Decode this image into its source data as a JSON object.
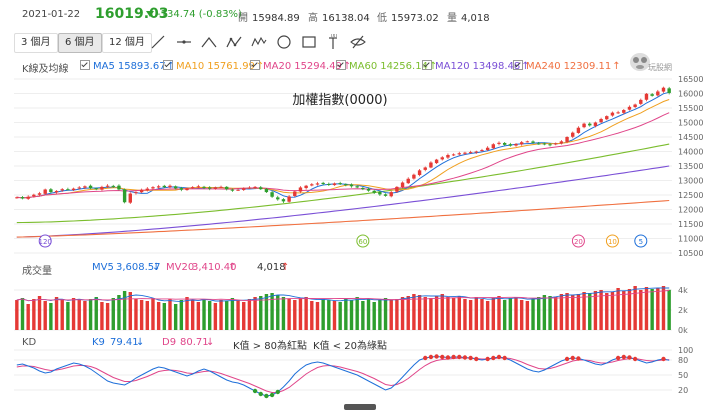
{
  "quote": {
    "date": "2021-01-22",
    "price": "16019.03",
    "change": "-134.74 (-0.83%)",
    "open_label": "開",
    "open": "15984.89",
    "high_label": "高",
    "high": "16138.04",
    "low_label": "低",
    "low": "15973.02",
    "volume_label": "量",
    "volume": "4,018"
  },
  "toolbar": {
    "ranges": [
      "3 個月",
      "6 個月",
      "12 個月"
    ],
    "active_range": "6 個月",
    "tools": [
      "line-tool-icon",
      "horizontal-line-icon",
      "peak-line-icon",
      "wave-icon",
      "multi-wave-icon",
      "circle-icon",
      "rectangle-icon",
      "text-tool-icon",
      "hide-icon"
    ]
  },
  "ma_row": {
    "label": "K線及均線",
    "items": [
      {
        "name": "MA5",
        "value": "15893.67",
        "arrow": "↑",
        "color": "#1e6fd9"
      },
      {
        "name": "MA10",
        "value": "15761.99",
        "arrow": "↑",
        "color": "#f0a020"
      },
      {
        "name": "MA20",
        "value": "15294.49",
        "arrow": "↑",
        "color": "#e0468a"
      },
      {
        "name": "MA60",
        "value": "14256.14",
        "arrow": "↑",
        "color": "#7bbd2e"
      },
      {
        "name": "MA120",
        "value": "13498.48",
        "arrow": "↑",
        "color": "#7a4fd6"
      },
      {
        "name": "MA240",
        "value": "12309.11",
        "arrow": "↑",
        "color": "#f07040"
      }
    ]
  },
  "logo_text": "玩股網",
  "volume_row": {
    "label": "成交量",
    "mv5_name": "MV5",
    "mv5_value": "3,608.57",
    "mv5_arrow": "↓",
    "mv20_name": "MV20",
    "mv20_value": "3,410.40",
    "mv20_arrow": "↑",
    "vol_value": "4,018",
    "vol_arrow": "↑"
  },
  "kd_row": {
    "label": "KD",
    "k_name": "K9",
    "k_value": "79.41",
    "k_arrow": "↓",
    "d_name": "D9",
    "d_value": "80.71",
    "d_arrow": "↓",
    "note1": "K值 > 80為紅點",
    "note2": "K值 < 20為綠點"
  },
  "colors": {
    "up": "#e53935",
    "down": "#2e9e2e",
    "grid": "#eeeeee"
  },
  "chart_data": [
    {
      "type": "candlestick",
      "title": "加權指數(0000)",
      "ylim": [
        10500,
        16500
      ],
      "yticks": [
        10500,
        11000,
        11500,
        12000,
        12500,
        13000,
        13500,
        14000,
        14500,
        15000,
        15500,
        16000,
        16500
      ],
      "markers": [
        "120",
        "60",
        "20",
        "10",
        "5"
      ],
      "close": [
        12420,
        12380,
        12440,
        12510,
        12560,
        12690,
        12600,
        12640,
        12700,
        12690,
        12720,
        12760,
        12800,
        12730,
        12700,
        12780,
        12820,
        12800,
        12690,
        12250,
        12550,
        12600,
        12680,
        12720,
        12770,
        12800,
        12770,
        12820,
        12730,
        12680,
        12730,
        12770,
        12800,
        12750,
        12720,
        12760,
        12780,
        12700,
        12660,
        12680,
        12730,
        12760,
        12780,
        12700,
        12600,
        12440,
        12350,
        12280,
        12450,
        12620,
        12760,
        12820,
        12870,
        12900,
        12880,
        12860,
        12900,
        12880,
        12840,
        12800,
        12760,
        12700,
        12650,
        12580,
        12520,
        12470,
        12600,
        12780,
        12930,
        13060,
        13200,
        13350,
        13450,
        13620,
        13720,
        13800,
        13880,
        13900,
        13940,
        13960,
        13980,
        14000,
        14050,
        14130,
        14250,
        14300,
        14230,
        14200,
        14260,
        14320,
        14350,
        14300,
        14270,
        14260,
        14230,
        14280,
        14350,
        14500,
        14650,
        14820,
        14960,
        14900,
        15000,
        15120,
        15220,
        15340,
        15350,
        15430,
        15540,
        15620,
        15780,
        15990,
        15920,
        16070,
        16200,
        16019
      ]
    },
    {
      "type": "bar",
      "name": "成交量",
      "ylim": [
        0,
        5000
      ],
      "yticks": [
        "4k",
        "2k",
        "0k"
      ],
      "values": [
        3000,
        3200,
        2600,
        3100,
        3400,
        2900,
        2700,
        3300,
        3100,
        2800,
        3200,
        3000,
        2900,
        3100,
        3300,
        2800,
        2700,
        3200,
        3500,
        3900,
        3800,
        3100,
        3000,
        2900,
        3200,
        2800,
        2700,
        3100,
        2600,
        3000,
        3300,
        3000,
        2800,
        3100,
        2900,
        2700,
        3000,
        2900,
        3200,
        3000,
        2800,
        3100,
        3300,
        3400,
        3600,
        3700,
        3500,
        3300,
        3100,
        3000,
        3200,
        3300,
        2900,
        2800,
        3100,
        3000,
        2900,
        2800,
        3200,
        3000,
        3300,
        2900,
        3100,
        2800,
        3000,
        3200,
        3000,
        3100,
        3300,
        3400,
        3600,
        3500,
        3300,
        3200,
        3400,
        3600,
        3300,
        3200,
        3400,
        3100,
        3000,
        3300,
        3100,
        2900,
        3200,
        3400,
        3000,
        3200,
        3300,
        3000,
        2900,
        3100,
        3300,
        3500,
        3400,
        3300,
        3600,
        3700,
        3500,
        3600,
        3800,
        3700,
        3900,
        4000,
        3700,
        3800,
        4200,
        3900,
        4100,
        4400,
        4000,
        4300,
        4100,
        4200,
        4400,
        4018
      ],
      "mv5": 3608.57,
      "mv20": 3410.4
    },
    {
      "type": "line",
      "name": "KD",
      "ylim": [
        0,
        100
      ],
      "yticks": [
        100,
        80,
        50,
        20
      ],
      "series": [
        {
          "name": "K9",
          "values": [
            70,
            72,
            68,
            64,
            58,
            54,
            56,
            62,
            66,
            70,
            74,
            72,
            68,
            62,
            54,
            46,
            38,
            34,
            32,
            30,
            36,
            44,
            50,
            56,
            62,
            66,
            64,
            60,
            56,
            52,
            48,
            52,
            58,
            62,
            58,
            52,
            46,
            40,
            36,
            34,
            30,
            24,
            18,
            12,
            8,
            10,
            16,
            26,
            38,
            52,
            62,
            70,
            74,
            76,
            74,
            70,
            66,
            62,
            58,
            54,
            50,
            44,
            38,
            32,
            26,
            20,
            24,
            34,
            46,
            58,
            70,
            80,
            84,
            86,
            87,
            86,
            85,
            86,
            86,
            85,
            84,
            82,
            80,
            82,
            84,
            86,
            84,
            80,
            74,
            68,
            62,
            58,
            56,
            60,
            66,
            72,
            78,
            82,
            84,
            83,
            80,
            76,
            72,
            70,
            74,
            80,
            84,
            86,
            85,
            82,
            78,
            74,
            76,
            80,
            82,
            79.41
          ]
        },
        {
          "name": "D9",
          "values": [
            66,
            68,
            68,
            67,
            64,
            61,
            59,
            60,
            62,
            65,
            68,
            69,
            69,
            67,
            63,
            57,
            51,
            45,
            41,
            37,
            37,
            39,
            43,
            47,
            52,
            57,
            59,
            60,
            59,
            57,
            54,
            53,
            55,
            57,
            58,
            56,
            53,
            49,
            45,
            41,
            37,
            33,
            28,
            23,
            18,
            15,
            15,
            19,
            25,
            34,
            43,
            52,
            59,
            65,
            68,
            69,
            68,
            66,
            63,
            60,
            57,
            53,
            48,
            43,
            37,
            31,
            29,
            31,
            36,
            43,
            52,
            61,
            69,
            75,
            79,
            81,
            82,
            83,
            84,
            84,
            84,
            83,
            82,
            82,
            83,
            84,
            84,
            83,
            80,
            76,
            71,
            67,
            63,
            62,
            63,
            66,
            70,
            74,
            78,
            80,
            80,
            79,
            76,
            74,
            74,
            76,
            79,
            81,
            83,
            83,
            81,
            79,
            78,
            79,
            80,
            80.71
          ]
        }
      ]
    }
  ]
}
